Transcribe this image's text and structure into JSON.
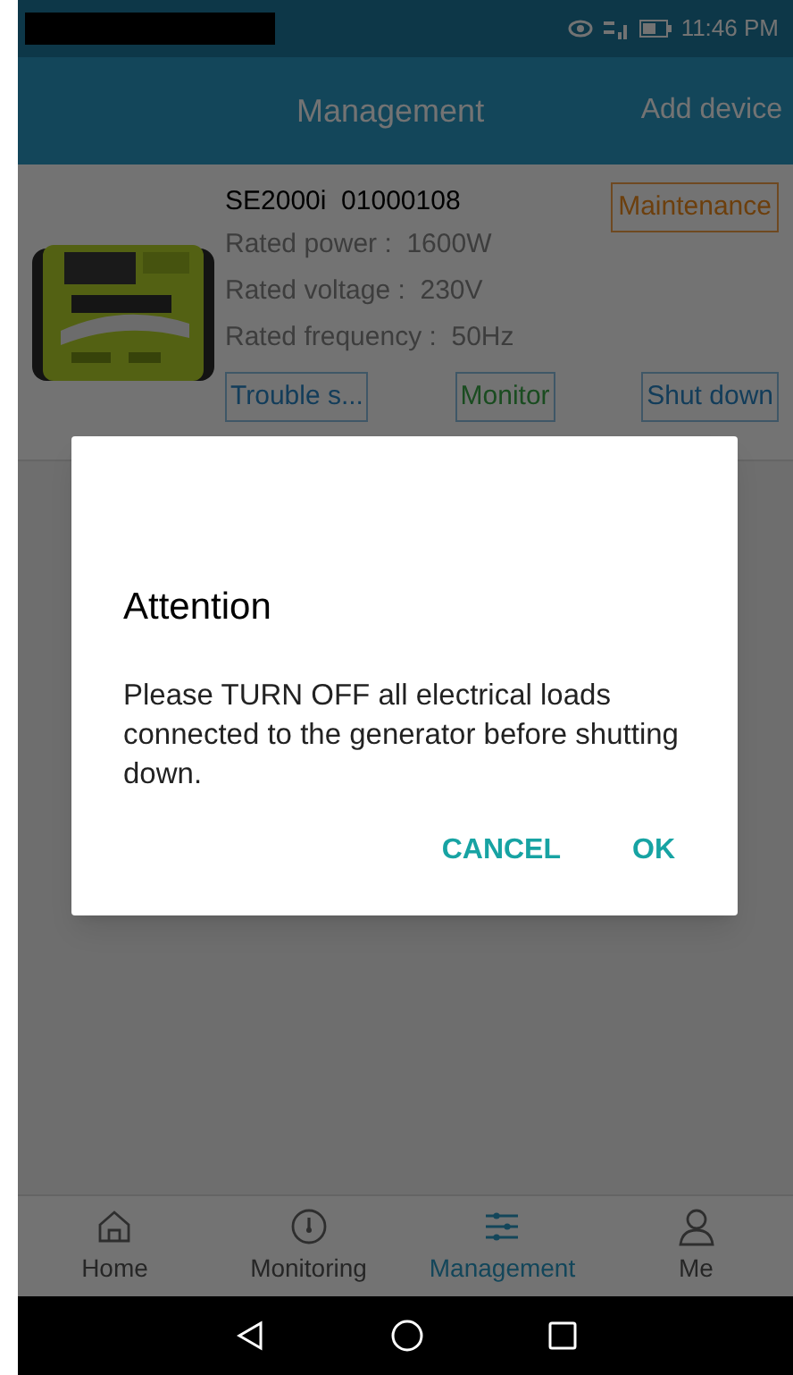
{
  "status_bar": {
    "time": "11:46 PM"
  },
  "header": {
    "title": "Management",
    "action": "Add device"
  },
  "device": {
    "name": "SE2000i  01000108",
    "specs": [
      "Rated power :  1600W",
      "Rated voltage :  230V",
      "Rated frequency :  50Hz"
    ],
    "maintenance": "Maintenance",
    "buttons": [
      {
        "label": "Trouble s...",
        "kind": "blue"
      },
      {
        "label": "Monitor",
        "kind": "green"
      },
      {
        "label": "Shut down",
        "kind": "blue"
      }
    ]
  },
  "dialog": {
    "title": "Attention",
    "message": "Please TURN OFF all electrical loads connected to the generator before shutting down.",
    "buttons": [
      "CANCEL",
      "OK"
    ]
  },
  "tabs": [
    {
      "label": "Home",
      "kind": "home",
      "selected": false
    },
    {
      "label": "Monitoring",
      "kind": "gauge",
      "selected": false
    },
    {
      "label": "Management",
      "kind": "sliders",
      "selected": true
    },
    {
      "label": "Me",
      "kind": "person",
      "selected": false
    }
  ]
}
